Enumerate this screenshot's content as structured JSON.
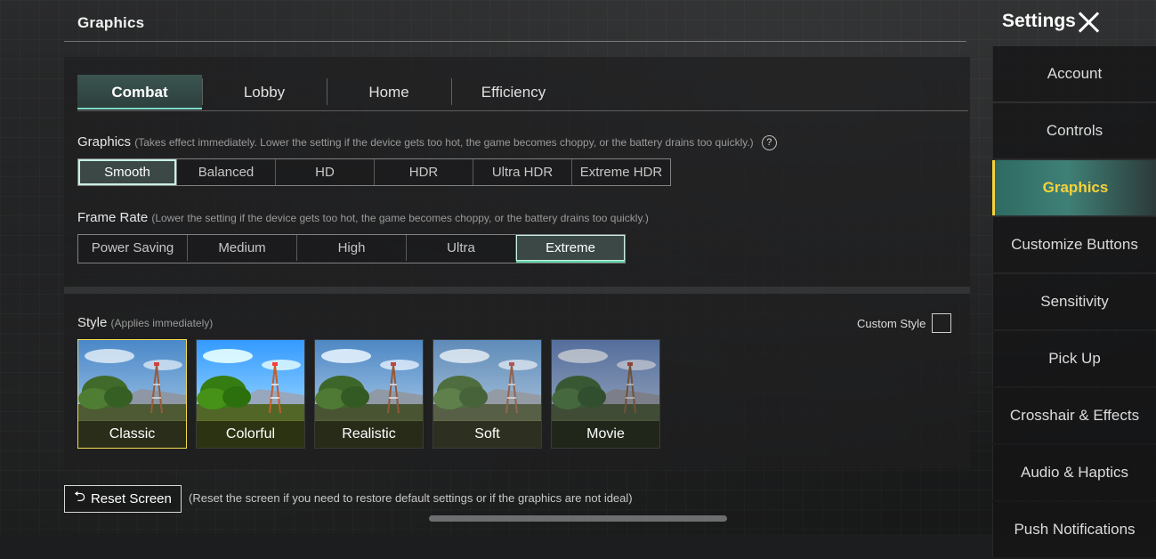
{
  "header": {
    "section_title": "Graphics"
  },
  "sidebar": {
    "title": "Settings",
    "items": [
      {
        "label": "Account",
        "active": false
      },
      {
        "label": "Controls",
        "active": false
      },
      {
        "label": "Graphics",
        "active": true
      },
      {
        "label": "Customize Buttons",
        "active": false
      },
      {
        "label": "Sensitivity",
        "active": false
      },
      {
        "label": "Pick Up",
        "active": false
      },
      {
        "label": "Crosshair & Effects",
        "active": false
      },
      {
        "label": "Audio & Haptics",
        "active": false
      },
      {
        "label": "Push Notifications",
        "active": false
      }
    ]
  },
  "tabs": [
    {
      "label": "Combat",
      "active": true
    },
    {
      "label": "Lobby",
      "active": false
    },
    {
      "label": "Home",
      "active": false
    },
    {
      "label": "Efficiency",
      "active": false
    }
  ],
  "graphics": {
    "label": "Graphics",
    "hint": "(Takes effect immediately. Lower the setting if the device gets too hot, the game becomes choppy, or the battery drains too quickly.)",
    "help_glyph": "?",
    "options": [
      "Smooth",
      "Balanced",
      "HD",
      "HDR",
      "Ultra HDR",
      "Extreme HDR"
    ],
    "selected": "Smooth"
  },
  "frame_rate": {
    "label": "Frame Rate",
    "hint": "(Lower the setting if the device gets too hot, the game becomes choppy, or the battery drains too quickly.)",
    "options": [
      "Power Saving",
      "Medium",
      "High",
      "Ultra",
      "Extreme"
    ],
    "selected": "Extreme"
  },
  "style": {
    "label": "Style",
    "hint": "(Applies immediately)",
    "custom_label": "Custom Style",
    "custom_checked": false,
    "options": [
      "Classic",
      "Colorful",
      "Realistic",
      "Soft",
      "Movie"
    ],
    "selected": "Classic"
  },
  "footer": {
    "reset_label": "Reset Screen",
    "reset_icon": "undo-icon",
    "reset_hint": "(Reset the screen if you need to restore default settings or if the graphics are not ideal)"
  },
  "colors": {
    "accent_teal": "#7fd8c6",
    "active_sidebar_text": "#f6d23a",
    "style_selected_border": "#f4dc4e"
  }
}
